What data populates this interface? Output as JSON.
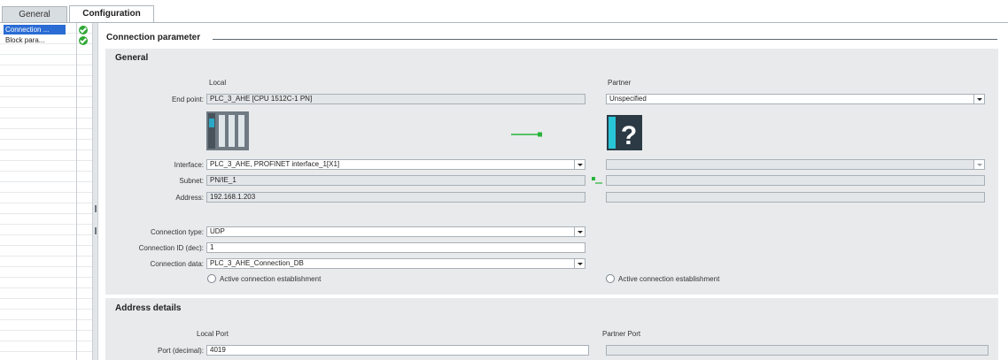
{
  "tabs": [
    {
      "label": "General",
      "active": false
    },
    {
      "label": "Configuration",
      "active": true
    }
  ],
  "nav": {
    "items": [
      {
        "label": "Connection ...",
        "selected": true,
        "status": "ok"
      },
      {
        "label": "Block para...",
        "selected": false,
        "status": "ok"
      }
    ]
  },
  "section": {
    "title": "Connection parameter"
  },
  "general": {
    "title": "General",
    "local_header": "Local",
    "partner_header": "Partner",
    "endpoint_label": "End point:",
    "endpoint_value": "PLC_3_AHE [CPU 1512C-1 PN]",
    "partner_endpoint_value": "Unspecified",
    "interface_label": "Interface:",
    "interface_value": "PLC_3_AHE, PROFINET interface_1[X1]",
    "subnet_label": "Subnet:",
    "subnet_value": "PN/IE_1",
    "address_label": "Address:",
    "address_value": "192.168.1.203",
    "connection_type_label": "Connection type:",
    "connection_type_value": "UDP",
    "connection_id_label": "Connection ID (dec):",
    "connection_id_value": "1",
    "connection_data_label": "Connection data:",
    "connection_data_value": "PLC_3_AHE_Connection_DB",
    "active_local_label": "Active connection establishment",
    "active_partner_label": "Active connection establishment",
    "partner_device_glyph": "?"
  },
  "address_details": {
    "title": "Address details",
    "local_port_header": "Local Port",
    "partner_port_header": "Partner Port",
    "port_label": "Port (decimal):",
    "port_value": "4019"
  },
  "colors": {
    "accent_blue": "#2a6cd4",
    "status_green": "#2fa836",
    "link_green": "#27b43a",
    "panel_gray": "#e8eaec"
  }
}
